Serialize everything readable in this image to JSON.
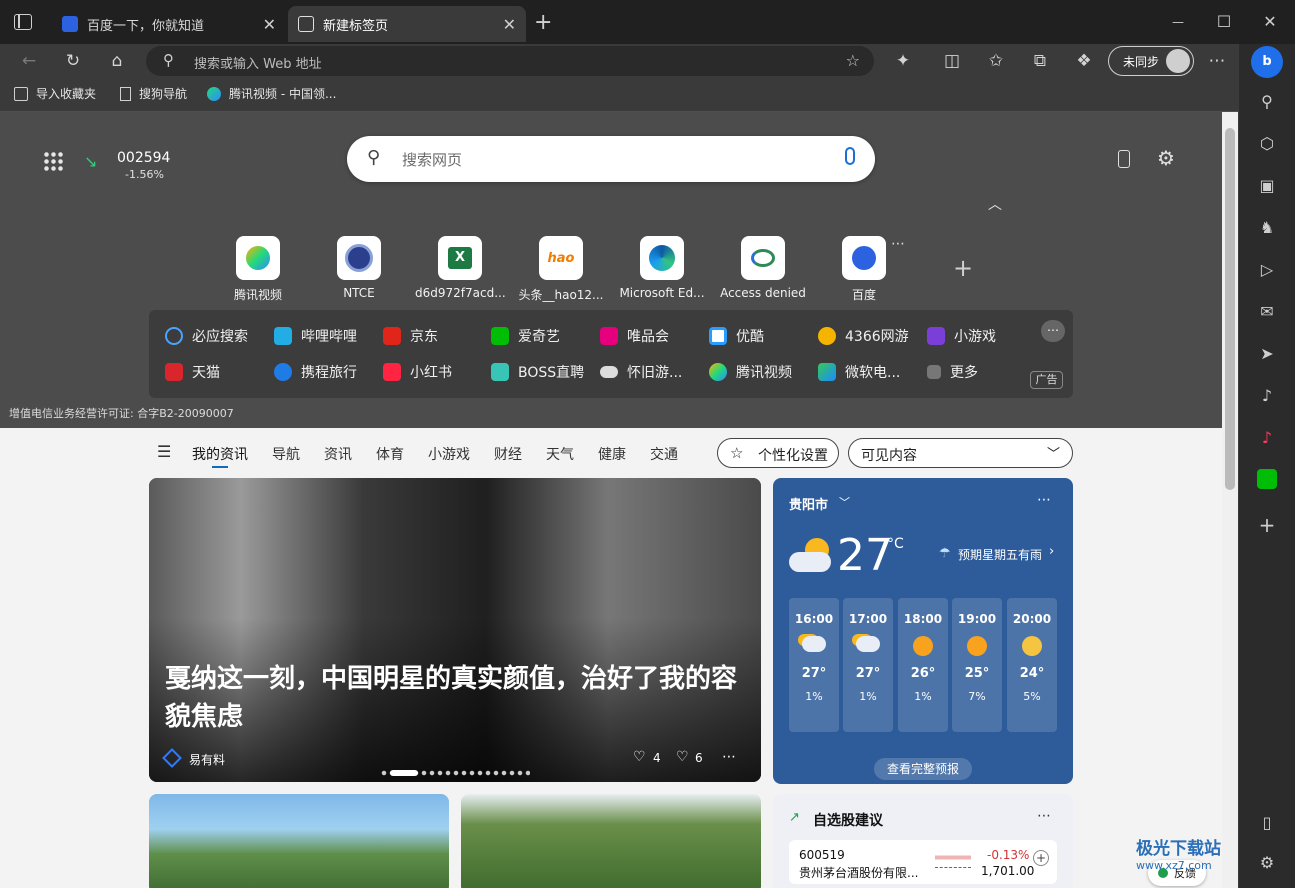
{
  "tabs": [
    {
      "title": "百度一下，你就知道",
      "close": "✕"
    },
    {
      "title": "新建标签页",
      "close": "✕"
    }
  ],
  "new_tab": "+",
  "window_controls": {
    "minimize": "—",
    "maximize": "☐",
    "close": "✕"
  },
  "address": {
    "placeholder": "搜索或输入 Web 地址"
  },
  "profile": {
    "label": "未同步"
  },
  "favorites": [
    {
      "label": "导入收藏夹"
    },
    {
      "label": "搜狗导航"
    },
    {
      "label": "腾讯视频 - 中国领..."
    }
  ],
  "stock": {
    "code": "002594",
    "change": "-1.56%"
  },
  "search": {
    "placeholder": "搜索网页"
  },
  "quick_links": [
    {
      "label": "腾讯视频"
    },
    {
      "label": "NTCE"
    },
    {
      "label": "d6d972f7acd..."
    },
    {
      "label": "头条__hao12..."
    },
    {
      "label": "Microsoft Ed..."
    },
    {
      "label": "Access denied"
    },
    {
      "label": "百度"
    }
  ],
  "nav_links": [
    {
      "label": "必应搜索"
    },
    {
      "label": "哔哩哔哩"
    },
    {
      "label": "京东"
    },
    {
      "label": "爱奇艺"
    },
    {
      "label": "唯品会"
    },
    {
      "label": "优酷"
    },
    {
      "label": "4366网游"
    },
    {
      "label": "小游戏"
    },
    {
      "label": "天猫"
    },
    {
      "label": "携程旅行"
    },
    {
      "label": "小红书"
    },
    {
      "label": "BOSS直聘"
    },
    {
      "label": "怀旧游..."
    },
    {
      "label": "腾讯视频"
    },
    {
      "label": "微软电..."
    },
    {
      "label": "更多"
    }
  ],
  "ad_badge": "广告",
  "license": "增值电信业务经营许可证: 合字B2-20090007",
  "feed_tabs": [
    "我的资讯",
    "导航",
    "资讯",
    "体育",
    "小游戏",
    "财经",
    "天气",
    "健康",
    "交通"
  ],
  "personalize": "个性化设置",
  "visible_content": "可见内容",
  "hero": {
    "headline": "戛纳这一刻，中国明星的真实颜值，治好了我的容貌焦虑",
    "source": "易有料",
    "likes": "4",
    "dislikes": "6"
  },
  "weather": {
    "city": "贵阳市",
    "temp": "27",
    "unit": "°C",
    "forecast_note": "预期星期五有雨",
    "hours": [
      {
        "time": "16:00",
        "temp": "27°",
        "rain": "1%"
      },
      {
        "time": "17:00",
        "temp": "27°",
        "rain": "1%"
      },
      {
        "time": "18:00",
        "temp": "26°",
        "rain": "1%"
      },
      {
        "time": "19:00",
        "temp": "25°",
        "rain": "7%"
      },
      {
        "time": "20:00",
        "temp": "24°",
        "rain": "5%"
      }
    ],
    "full_forecast": "查看完整预报"
  },
  "stock_card": {
    "title": "自选股建议",
    "code": "600519",
    "name": "贵州茅台酒股份有限...",
    "change": "-0.13%",
    "price": "1,701.00",
    "add": "+"
  },
  "feedback": "反馈",
  "watermark": "极光下载站",
  "watermark_url": "www.xz7.com"
}
